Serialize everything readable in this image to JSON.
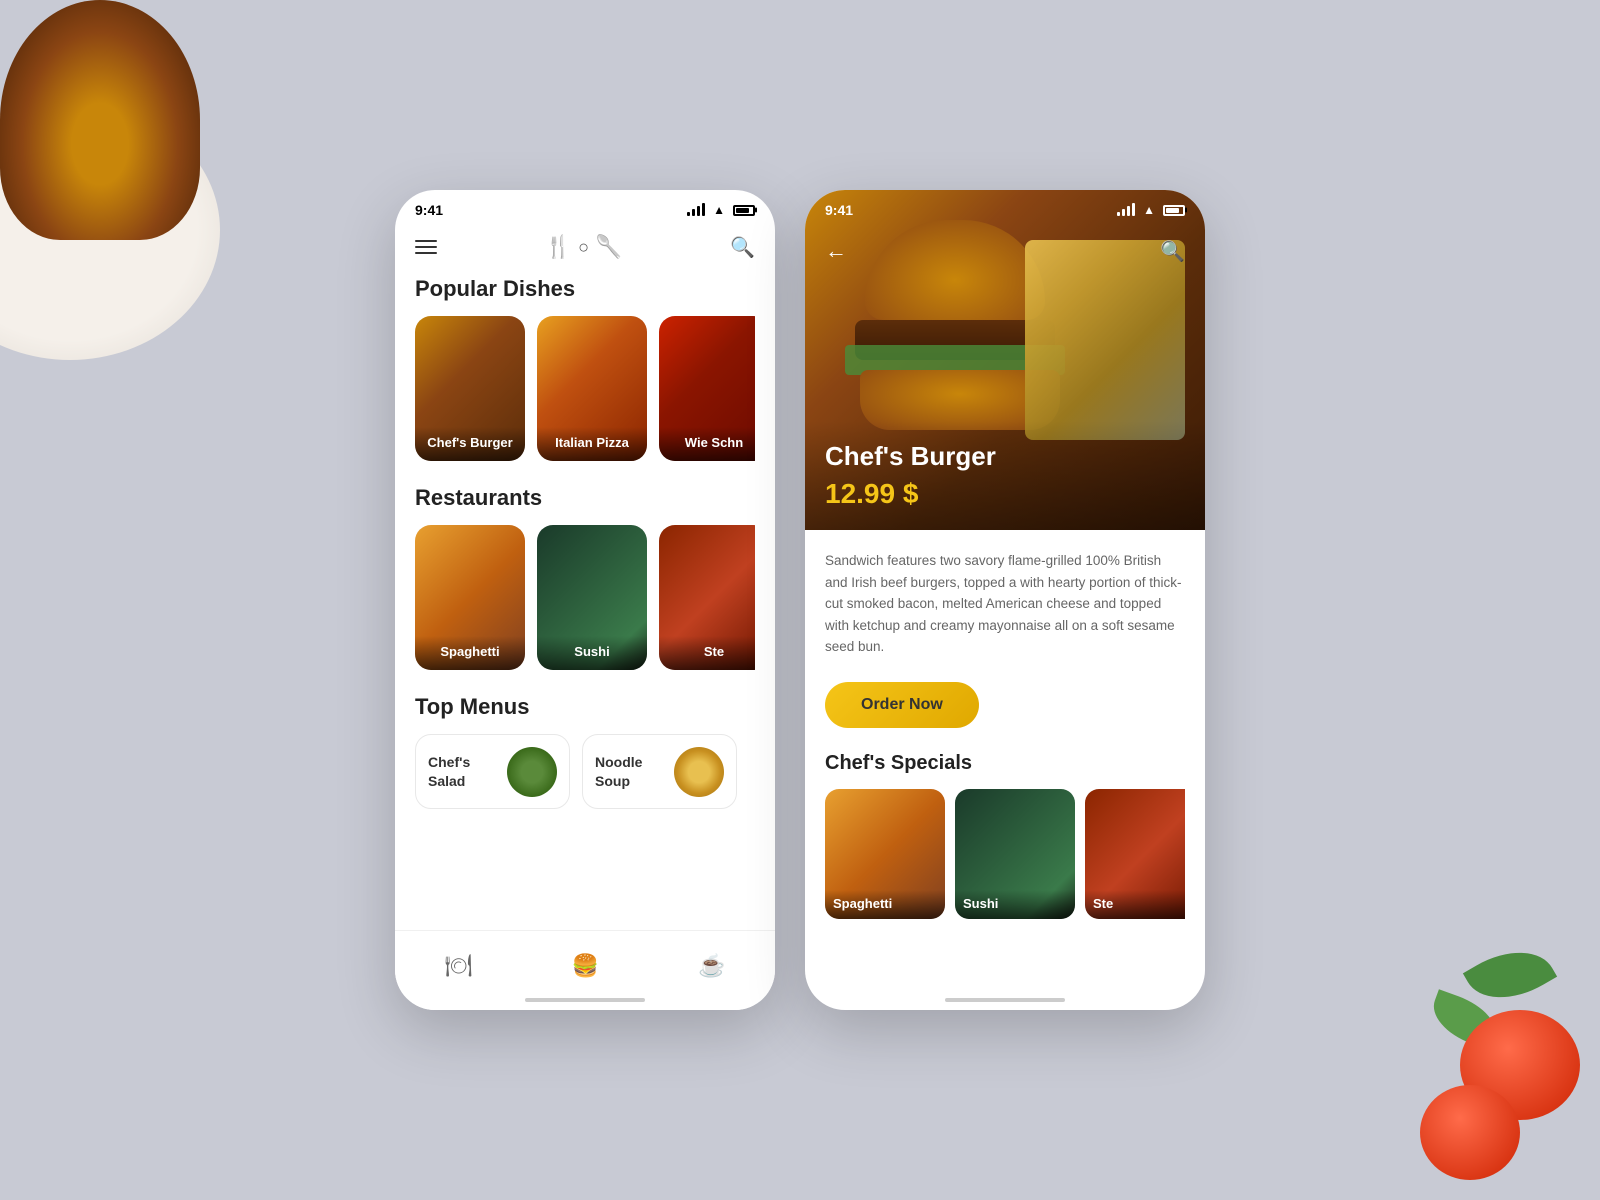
{
  "background": {
    "color": "#c8cad4"
  },
  "phone1": {
    "status": {
      "time": "9:41",
      "signal": "full",
      "wifi": "on",
      "battery": "70"
    },
    "header": {
      "menu_icon_label": "menu",
      "logo_icon": "🍽",
      "search_icon": "🔍"
    },
    "popular_dishes": {
      "title": "Popular Dishes",
      "items": [
        {
          "name": "Chef's Burger",
          "bg": "dish-burger-bg"
        },
        {
          "name": "Italian Pizza",
          "bg": "dish-pizza-bg"
        },
        {
          "name": "Wie Schn",
          "bg": "dish-wie-bg"
        }
      ]
    },
    "restaurants": {
      "title": "Restaurants",
      "items": [
        {
          "name": "Spaghetti",
          "bg": "rest-spaghetti-bg"
        },
        {
          "name": "Sushi",
          "bg": "rest-sushi-bg"
        },
        {
          "name": "Ste",
          "bg": "rest-steak-bg"
        }
      ]
    },
    "top_menus": {
      "title": "Top Menus",
      "items": [
        {
          "name": "Chef's\nSalad",
          "display": "Chef's Salad",
          "bg": "menu-salad-bg"
        },
        {
          "name": "Noodle\nSoup",
          "display": "Noodle Soup",
          "bg": "menu-soup-bg"
        }
      ]
    },
    "bottom_nav": {
      "items": [
        "🍽",
        "🍔",
        "☕"
      ]
    }
  },
  "phone2": {
    "status": {
      "time": "9:41",
      "signal": "full",
      "wifi": "on",
      "battery": "70"
    },
    "hero": {
      "title": "Chef's Burger",
      "price": "12.99 $"
    },
    "description": "Sandwich features two savory flame-grilled 100% British and Irish beef burgers, topped a with hearty portion of thick-cut smoked bacon, melted American cheese and topped with ketchup and creamy mayonnaise all on a soft sesame seed bun.",
    "order_button": "Order Now",
    "specials": {
      "title": "Chef's Specials",
      "items": [
        {
          "name": "Spaghetti",
          "bg": "rest-spaghetti-bg"
        },
        {
          "name": "Sushi",
          "bg": "rest-sushi-bg"
        },
        {
          "name": "Ste",
          "bg": "rest-steak-bg"
        }
      ]
    }
  }
}
